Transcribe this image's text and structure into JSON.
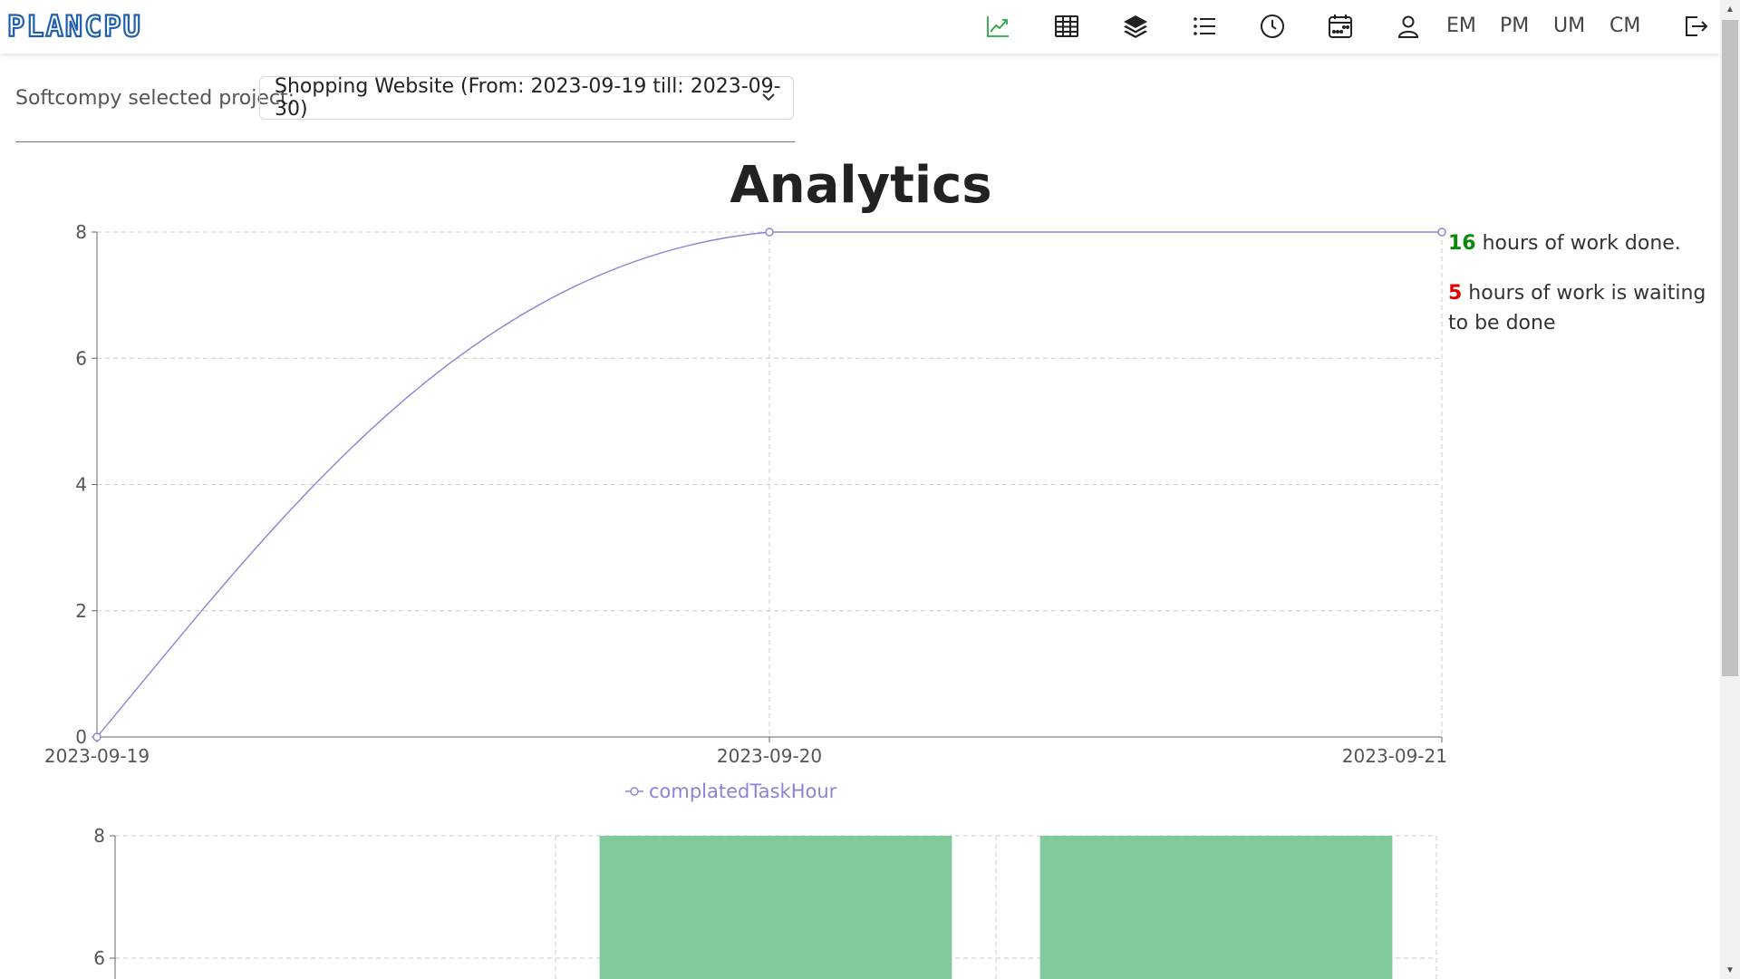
{
  "app": {
    "logo_text": "PLANCPU"
  },
  "nav": {
    "icons": [
      "chart-line-icon",
      "table-icon",
      "layers-icon",
      "list-icon",
      "clock-icon",
      "calendar-icon",
      "user-icon"
    ],
    "text_items": [
      "EM",
      "PM",
      "UM",
      "CM"
    ],
    "logout_icon": "logout-icon",
    "active_color": "#28a745"
  },
  "project": {
    "label": "Softcompy selected project:",
    "selected": "Shopping Website (From: 2023-09-19 till: 2023-09-30)"
  },
  "page": {
    "title": "Analytics"
  },
  "stats": {
    "done_value": "16",
    "done_text": " hours of work done.",
    "waiting_value": "5",
    "waiting_text": " hours of work is waiting to be done",
    "done_color": "#008000",
    "waiting_color": "#e00000"
  },
  "chart_data": [
    {
      "type": "line",
      "x": [
        "2023-09-19",
        "2023-09-20",
        "2023-09-21"
      ],
      "series": [
        {
          "name": "complatedTaskHour",
          "values": [
            0,
            8,
            8
          ],
          "color": "#8884d8"
        }
      ],
      "ylim": [
        0,
        8
      ],
      "yticks": [
        0,
        2,
        4,
        6,
        8
      ],
      "grid": true,
      "legend": "bottom-center"
    },
    {
      "type": "bar",
      "values_visible": [
        null,
        8,
        8
      ],
      "ylim_visible": [
        6,
        8
      ],
      "yticks_visible": [
        6,
        8
      ],
      "color": "#82ca9d",
      "grid": true
    }
  ]
}
